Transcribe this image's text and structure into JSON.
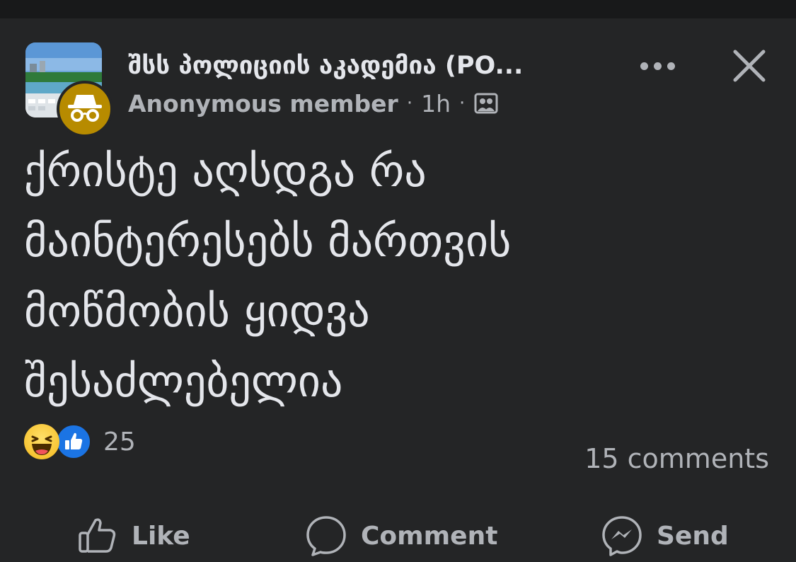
{
  "post": {
    "group_name": "შსს პოლიციის აკადემია (PO...",
    "author": "Anonymous member",
    "time": "1h",
    "separator": "·",
    "privacy_icon": "group-members-icon",
    "text_lines": [
      "ქრისტე აღსდგა რა",
      "მაინტერესებს მართვის",
      "მოწმობის ყიდვა",
      "შესაძლებელია"
    ]
  },
  "reactions": {
    "icons": [
      "haha-reaction-icon",
      "like-reaction-icon"
    ],
    "count": "25",
    "comments": "15 comments"
  },
  "actions": {
    "like": "Like",
    "comment": "Comment",
    "send": "Send"
  },
  "colors": {
    "background": "#242526",
    "top_bar": "#18191a",
    "primary_text": "#e4e6eb",
    "secondary_text": "#b0b3b8",
    "anonymous_avatar": "#b78b00",
    "like_blue": "#1b74e4"
  }
}
